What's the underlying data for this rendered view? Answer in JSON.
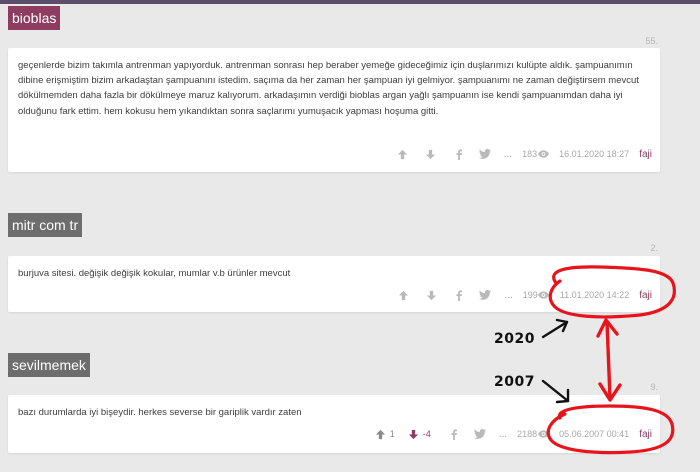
{
  "entries": [
    {
      "title": "bioblas",
      "number": "55.",
      "text": "geçenlerde bizim takımla antrenman yapıyorduk. antrenman sonrası hep beraber yemeğe gideceğimiz için duşlarımızı kulüpte aldık. şampuanımın dibine erişmiştim bizim arkadaştan şampuanını istedim. saçıma da her zaman her şampuan iyi gelmiyor. şampuanımı ne zaman değiştirsem mevcut dökülmemden daha fazla bir dökülmeye maruz kalıyorum. arkadaşımın verdiği bioblas argan yağlı şampuanın ise kendi şampuanımdan daha iyi olduğunu fark ettim. hem kokusu hem yıkandıktan sonra saçlarımı yumuşacık yapması hoşuma gitti.",
      "views": "183",
      "date": "16.01.2020 18:27",
      "author": "faji",
      "more": "..."
    },
    {
      "title": "mitr com tr",
      "number": "2.",
      "text": "burjuva sitesi. değişik değişik kokular, mumlar v.b ürünler mevcut",
      "views": "199",
      "date": "11.01.2020 14:22",
      "author": "faji",
      "more": "..."
    },
    {
      "title": "sevilmemek",
      "number": "9.",
      "text": "bazı durumlarda iyi bişeydir. herkes severse bir gariplik vardır zaten",
      "upvotes": "1",
      "downvotes": "-4",
      "views": "2188",
      "date": "05.06.2007 00:41",
      "author": "faji",
      "more": "..."
    }
  ],
  "annotations": {
    "label_2020": "2020",
    "label_2007": "2007",
    "color": "#e8141c"
  },
  "colors": {
    "accent": "#8e3d61",
    "muted_tag": "#6d6d6d",
    "background": "#e9e9ea",
    "topbar": "#5a4e6b"
  },
  "icons": [
    "arrow-up-icon",
    "arrow-down-icon",
    "facebook-icon",
    "twitter-icon",
    "eye-icon"
  ]
}
